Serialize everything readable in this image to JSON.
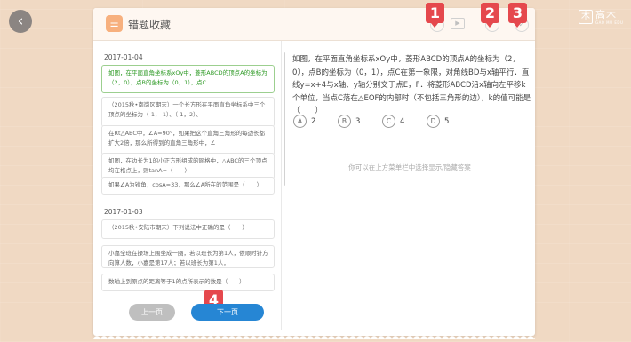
{
  "nav": {
    "back_glyph": "‹",
    "back_icon": "chevron-left-icon"
  },
  "logo": {
    "mark": "木",
    "name": "高木",
    "subtitle": "GAO MU EDU"
  },
  "page": {
    "title": "错题收藏",
    "title_icon": "document-icon"
  },
  "header_icons": {
    "one": "✓",
    "play": "▶",
    "two": "✓",
    "three": "✓"
  },
  "badges": [
    "1",
    "2",
    "3",
    "4"
  ],
  "groups": [
    {
      "date": "2017-01-04",
      "items": [
        "如图，在平面直角坐标系xOy中，菱形ABCD的顶点A的坐标为（2，0），点B的坐标为（0，1），点C",
        "（2015秋•南岗区期末）一个长方形在平面直角坐标系中三个顶点的坐标为（-1，-1）、（-1，2）、",
        "在Rt△ABC中，∠A=90°，如果把这个直角三角形的每边长都扩大2倍，那么所得到的直角三角形中，∠",
        "如图，在边长为1的小正方形组成的网格中，△ABC的三个顶点均在格点上，则tanA=（　　）",
        "如果∠A为锐角，cosA=33，那么∠A所在的范围是（　　）"
      ]
    },
    {
      "date": "2017-01-03",
      "items": [
        "（2015秋•安陆市期末）下列说法中正确的是（　　）",
        "小嘉全班在操场上围坐成一圈，若以班长为第1人，依顺时针方向算人数，小嘉是第17人；若以班长为第1人，",
        "数轴上到原点的距离等于1的点所表示的数是（　　）"
      ]
    }
  ],
  "pager": {
    "prev": "上一页",
    "next": "下一页"
  },
  "question": {
    "text": "如图，在平面直角坐标系xOy中，菱形ABCD的顶点A的坐标为（2，0），点B的坐标为（0，1），点C在第一象限，对角线BD与x轴平行．直线y=x+4与x轴、y轴分别交于点E，F．将菱形ABCD沿x轴向左平移k个单位，当点C落在△EOF的内部时（不包括三角形的边），k的值可能是（　　）",
    "options": [
      {
        "letter": "A",
        "value": "2"
      },
      {
        "letter": "B",
        "value": "3"
      },
      {
        "letter": "C",
        "value": "4"
      },
      {
        "letter": "D",
        "value": "5"
      }
    ]
  },
  "hint": "你可以在上方菜单栏中选择显示/隐藏答案"
}
